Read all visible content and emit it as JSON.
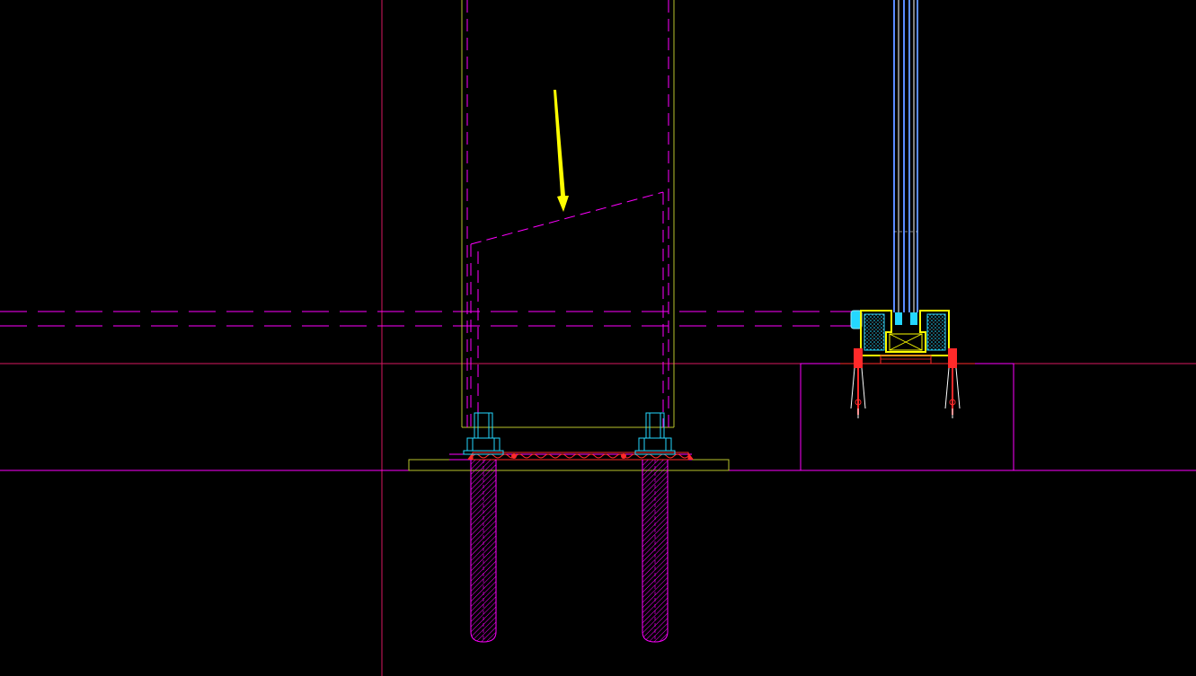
{
  "canvas": {
    "background": "#000000"
  },
  "colors": {
    "magenta": "#ff00ff",
    "red_line": "#e0105a",
    "grid_red": "#d81760",
    "yellow_green": "#b9c52d",
    "cyan": "#24d7ff",
    "cyan_light": "#8fe8ff",
    "weld_red": "#ff2a2a",
    "yellow": "#ffff00",
    "white": "#ffffff",
    "glass_blue": "#5a8bff"
  },
  "drawing": {
    "description_free": true,
    "elements": [
      "steel-column",
      "inclined-cut-line",
      "annotation-arrow",
      "base-plate",
      "anchor-bolts",
      "weld-bead",
      "concrete-plinth",
      "curtain-wall-mullion",
      "glass-panel",
      "dashed-beam-lines",
      "grid-lines"
    ]
  }
}
